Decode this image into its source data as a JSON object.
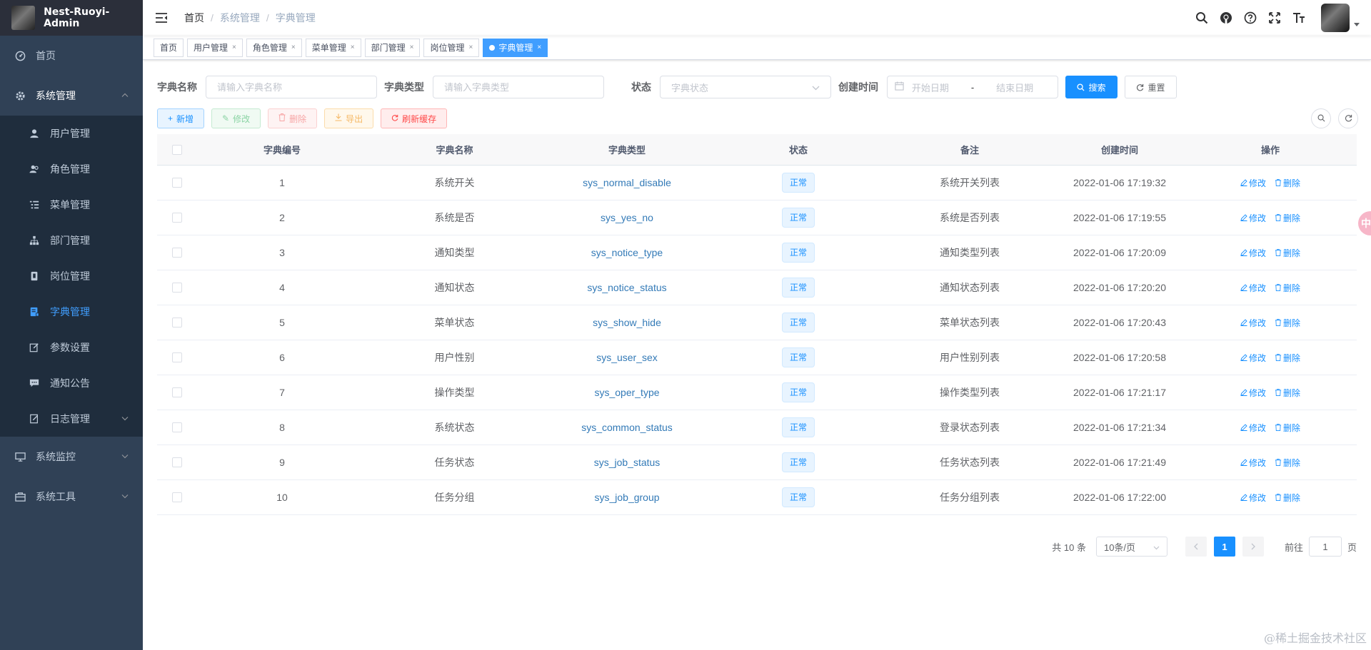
{
  "app": {
    "title": "Nest-Ruoyi-Admin"
  },
  "sidebar": {
    "home": "首页",
    "system": {
      "label": "系统管理",
      "items": [
        {
          "label": "用户管理",
          "icon": "user-icon"
        },
        {
          "label": "角色管理",
          "icon": "peoples-icon"
        },
        {
          "label": "菜单管理",
          "icon": "tree-table-icon"
        },
        {
          "label": "部门管理",
          "icon": "tree-icon"
        },
        {
          "label": "岗位管理",
          "icon": "post-icon"
        },
        {
          "label": "字典管理",
          "icon": "dict-icon",
          "active": true
        },
        {
          "label": "参数设置",
          "icon": "edit-icon"
        },
        {
          "label": "通知公告",
          "icon": "message-icon"
        },
        {
          "label": "日志管理",
          "icon": "log-icon"
        }
      ]
    },
    "monitor": "系统监控",
    "tool": "系统工具"
  },
  "breadcrumb": [
    "首页",
    "系统管理",
    "字典管理"
  ],
  "tags": [
    {
      "label": "首页",
      "closable": false
    },
    {
      "label": "用户管理",
      "closable": true
    },
    {
      "label": "角色管理",
      "closable": true
    },
    {
      "label": "菜单管理",
      "closable": true
    },
    {
      "label": "部门管理",
      "closable": true
    },
    {
      "label": "岗位管理",
      "closable": true
    },
    {
      "label": "字典管理",
      "closable": true,
      "active": true
    }
  ],
  "search": {
    "dict_name_label": "字典名称",
    "dict_name_placeholder": "请输入字典名称",
    "dict_type_label": "字典类型",
    "dict_type_placeholder": "请输入字典类型",
    "status_label": "状态",
    "status_placeholder": "字典状态",
    "create_time_label": "创建时间",
    "start_placeholder": "开始日期",
    "end_placeholder": "结束日期",
    "range_separator": "-",
    "search_button": "搜索",
    "reset_button": "重置"
  },
  "toolbar": {
    "add": "新增",
    "edit": "修改",
    "delete": "删除",
    "export": "导出",
    "refresh_cache": "刷新缓存"
  },
  "table": {
    "headers": [
      "字典编号",
      "字典名称",
      "字典类型",
      "状态",
      "备注",
      "创建时间",
      "操作"
    ],
    "edit_label": "修改",
    "delete_label": "删除",
    "rows": [
      {
        "id": "1",
        "name": "系统开关",
        "type": "sys_normal_disable",
        "status": "正常",
        "remark": "系统开关列表",
        "created": "2022-01-06 17:19:32"
      },
      {
        "id": "2",
        "name": "系统是否",
        "type": "sys_yes_no",
        "status": "正常",
        "remark": "系统是否列表",
        "created": "2022-01-06 17:19:55"
      },
      {
        "id": "3",
        "name": "通知类型",
        "type": "sys_notice_type",
        "status": "正常",
        "remark": "通知类型列表",
        "created": "2022-01-06 17:20:09"
      },
      {
        "id": "4",
        "name": "通知状态",
        "type": "sys_notice_status",
        "status": "正常",
        "remark": "通知状态列表",
        "created": "2022-01-06 17:20:20"
      },
      {
        "id": "5",
        "name": "菜单状态",
        "type": "sys_show_hide",
        "status": "正常",
        "remark": "菜单状态列表",
        "created": "2022-01-06 17:20:43"
      },
      {
        "id": "6",
        "name": "用户性别",
        "type": "sys_user_sex",
        "status": "正常",
        "remark": "用户性别列表",
        "created": "2022-01-06 17:20:58"
      },
      {
        "id": "7",
        "name": "操作类型",
        "type": "sys_oper_type",
        "status": "正常",
        "remark": "操作类型列表",
        "created": "2022-01-06 17:21:17"
      },
      {
        "id": "8",
        "name": "系统状态",
        "type": "sys_common_status",
        "status": "正常",
        "remark": "登录状态列表",
        "created": "2022-01-06 17:21:34"
      },
      {
        "id": "9",
        "name": "任务状态",
        "type": "sys_job_status",
        "status": "正常",
        "remark": "任务状态列表",
        "created": "2022-01-06 17:21:49"
      },
      {
        "id": "10",
        "name": "任务分组",
        "type": "sys_job_group",
        "status": "正常",
        "remark": "任务分组列表",
        "created": "2022-01-06 17:22:00"
      }
    ]
  },
  "pagination": {
    "total": "共 10 条",
    "page_size": "10条/页",
    "current_page": "1",
    "goto_prefix": "前往",
    "goto_value": "1",
    "goto_suffix": "页"
  },
  "floating_badge": "中",
  "watermark": "@稀土掘金技术社区",
  "colors": {
    "primary": "#1890ff",
    "sidebar_bg": "#304156",
    "submenu_bg": "#1f2d3d",
    "danger": "#ff4949"
  }
}
